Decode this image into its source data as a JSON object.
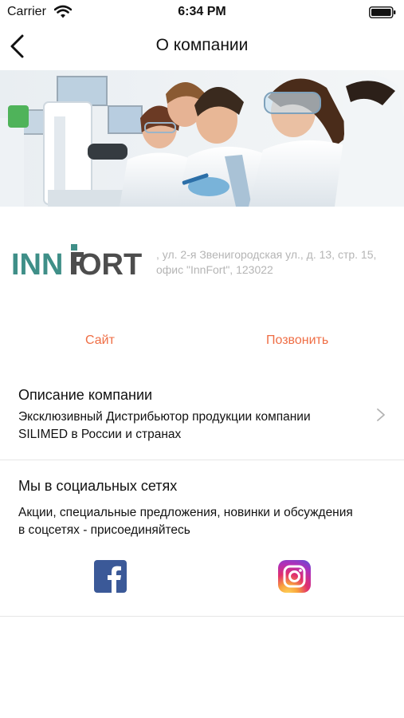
{
  "status_bar": {
    "carrier": "Carrier",
    "time": "6:34 PM"
  },
  "nav": {
    "title": "О компании"
  },
  "company": {
    "logo_text": "INNFORT",
    "address": ", ул. 2-я Звенигородская ул., д. 13, стр. 15, офис \"InnFort\", 123022"
  },
  "actions": {
    "site_label": "Сайт",
    "call_label": "Позвонить"
  },
  "description": {
    "title": "Описание компании",
    "text": "Эксклюзивный Дистрибьютор продукции компании SILIMED в России и странах"
  },
  "social": {
    "title": "Мы в социальных сетях",
    "text": "Акции, специальные предложения, новинки и обсуждения в соцсетях - присоединяйтесь",
    "links": [
      "facebook-icon",
      "instagram-icon"
    ]
  },
  "colors": {
    "accent": "#ef6e45",
    "logo_teal": "#3f8f88",
    "logo_gray": "#4d4d4d",
    "facebook": "#3b5998"
  }
}
